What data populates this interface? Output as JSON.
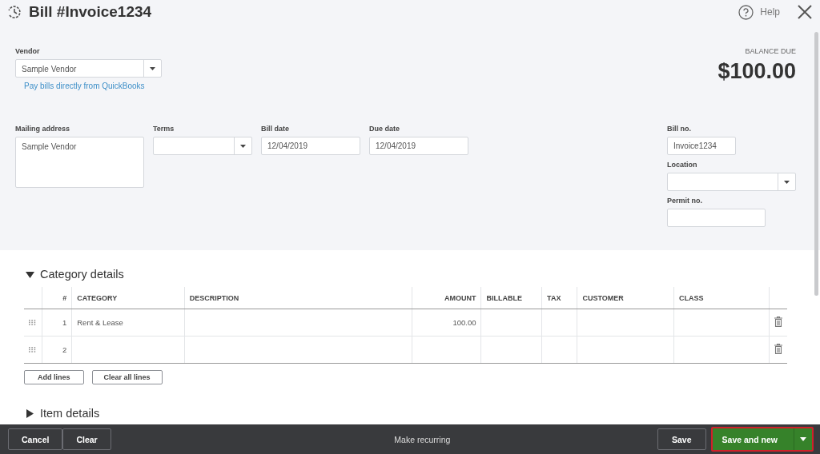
{
  "header": {
    "title": "Bill #Invoice1234",
    "help": "Help"
  },
  "vendor": {
    "label": "Vendor",
    "value": "Sample Vendor",
    "link": "Pay bills directly from QuickBooks"
  },
  "balance": {
    "label": "BALANCE DUE",
    "amount": "$100.00"
  },
  "fields": [
    {
      "kind": "textarea",
      "label": "Mailing address",
      "value": "Sample Vendor"
    },
    {
      "kind": "select",
      "label": "Terms"
    },
    {
      "kind": "text",
      "label": "Bill date",
      "value": "12/04/2019"
    },
    {
      "kind": "text",
      "label": "Due date",
      "value": "12/04/2019"
    }
  ],
  "side_fields": [
    {
      "kind": "text",
      "label": "Bill no.",
      "value": "Invoice1234"
    },
    {
      "kind": "select",
      "label": "Location"
    },
    {
      "kind": "text",
      "label": "Permit no."
    }
  ],
  "category_section": {
    "title": "Category details",
    "expanded": true
  },
  "table": {
    "columns": [
      "#",
      "CATEGORY",
      "DESCRIPTION",
      "AMOUNT",
      "BILLABLE",
      "TAX",
      "CUSTOMER",
      "CLASS"
    ],
    "rows": [
      {
        "num": "1",
        "category": "Rent & Lease",
        "amount": "100.00"
      },
      {
        "num": "2"
      }
    ]
  },
  "table_buttons": [
    "Add lines",
    "Clear all lines"
  ],
  "item_section": {
    "title": "Item details",
    "expanded": false
  },
  "footer": {
    "left_buttons": [
      "Cancel",
      "Clear"
    ],
    "center": "Make recurring",
    "save": "Save",
    "save_new": {
      "label": "Save and new",
      "highlighted": true
    }
  }
}
